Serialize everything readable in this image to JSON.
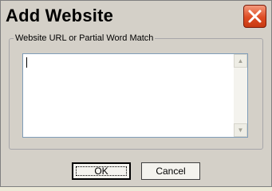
{
  "window": {
    "title": "Add Website",
    "close_icon": "close-icon"
  },
  "group": {
    "label": "Website URL or Partial Word Match"
  },
  "url_input": {
    "value": ""
  },
  "buttons": {
    "ok": "OK",
    "cancel": "Cancel"
  }
}
